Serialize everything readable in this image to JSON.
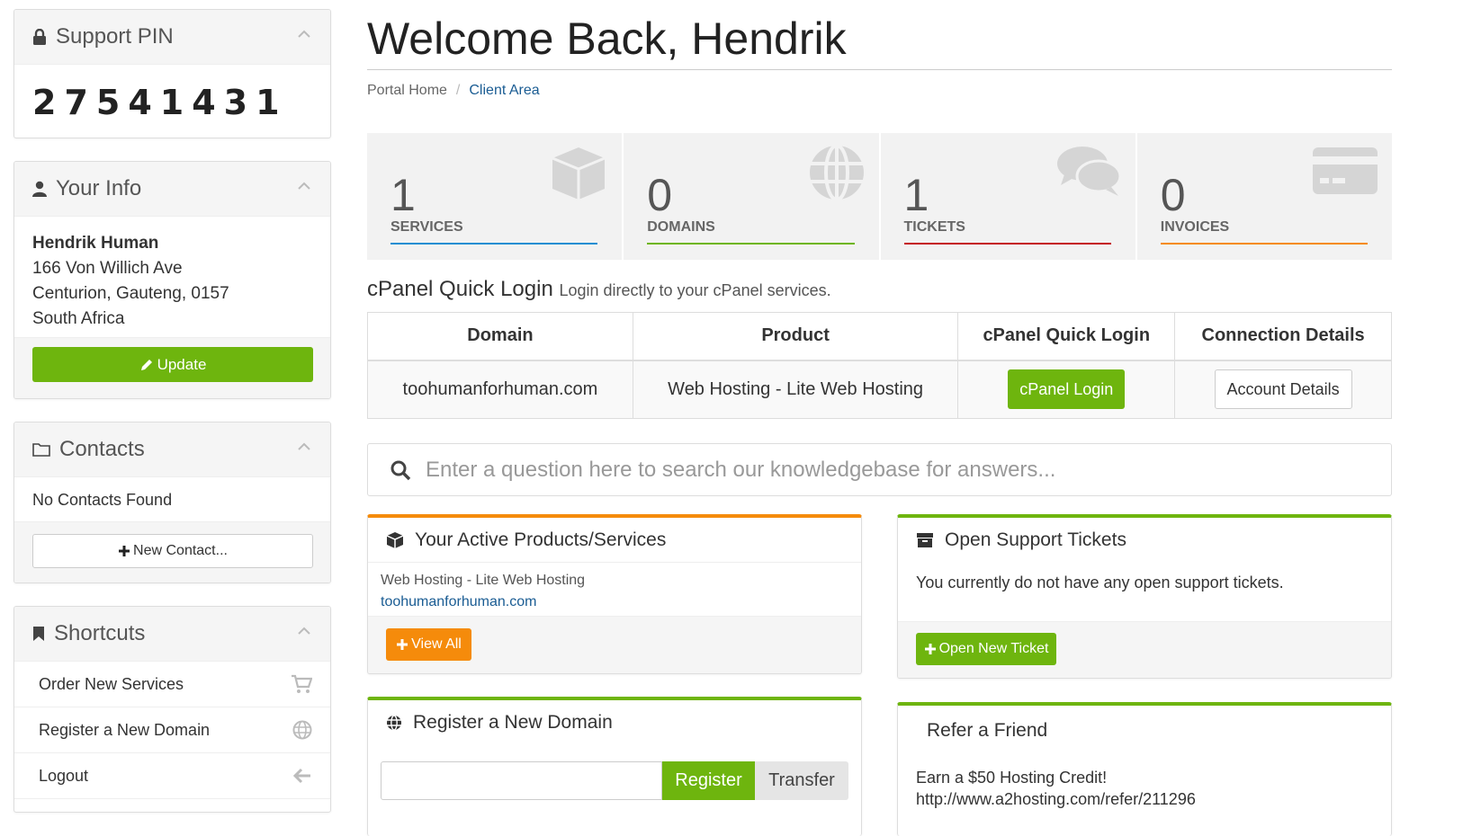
{
  "support_pin": {
    "title": "Support PIN",
    "value": "27541431"
  },
  "your_info": {
    "title": "Your Info",
    "name": "Hendrik Human",
    "address1": "166 Von Willich Ave",
    "address2": "Centurion, Gauteng, 0157",
    "country": "South Africa",
    "update_label": "Update"
  },
  "contacts": {
    "title": "Contacts",
    "empty_text": "No Contacts Found",
    "new_label": "New Contact..."
  },
  "shortcuts": {
    "title": "Shortcuts",
    "items": [
      {
        "label": "Order New Services",
        "icon": "cart-icon"
      },
      {
        "label": "Register a New Domain",
        "icon": "globe-icon"
      },
      {
        "label": "Logout",
        "icon": "arrow-left-icon"
      }
    ]
  },
  "header": {
    "welcome": "Welcome Back, Hendrik"
  },
  "breadcrumb": {
    "home": "Portal Home",
    "separator": "/",
    "current": "Client Area"
  },
  "tiles": [
    {
      "count": "1",
      "label": "SERVICES",
      "color": "#1a8ed2",
      "icon": "cube-icon"
    },
    {
      "count": "0",
      "label": "DOMAINS",
      "color": "#6eb50e",
      "icon": "globe-icon"
    },
    {
      "count": "1",
      "label": "TICKETS",
      "color": "#c4121a",
      "icon": "comments-icon"
    },
    {
      "count": "0",
      "label": "INVOICES",
      "color": "#f58b0b",
      "icon": "credit-card-icon"
    }
  ],
  "cpanel": {
    "title": "cPanel Quick Login",
    "subtitle": "Login directly to your cPanel services.",
    "headers": [
      "Domain",
      "Product",
      "cPanel Quick Login",
      "Connection Details"
    ],
    "row": {
      "domain": "toohumanforhuman.com",
      "product": "Web Hosting - Lite Web Hosting",
      "login_label": "cPanel Login",
      "details_label": "Account Details"
    }
  },
  "kb_search": {
    "placeholder": "Enter a question here to search our knowledgebase for answers..."
  },
  "products": {
    "title": "Your Active Products/Services",
    "item_name": "Web Hosting - Lite Web Hosting",
    "item_domain": "toohumanforhuman.com",
    "view_all_label": "View All"
  },
  "tickets": {
    "title": "Open Support Tickets",
    "empty_text": "You currently do not have any open support tickets.",
    "open_label": "Open New Ticket"
  },
  "register_domain": {
    "title": "Register a New Domain",
    "register_label": "Register",
    "transfer_label": "Transfer"
  },
  "refer": {
    "title": "Refer a Friend",
    "text": "Earn a $50 Hosting Credit!",
    "url": "http://www.a2hosting.com/refer/211296"
  },
  "colors": {
    "green": "#6eb50e",
    "orange": "#f58b0b",
    "link": "#1a5c93"
  }
}
